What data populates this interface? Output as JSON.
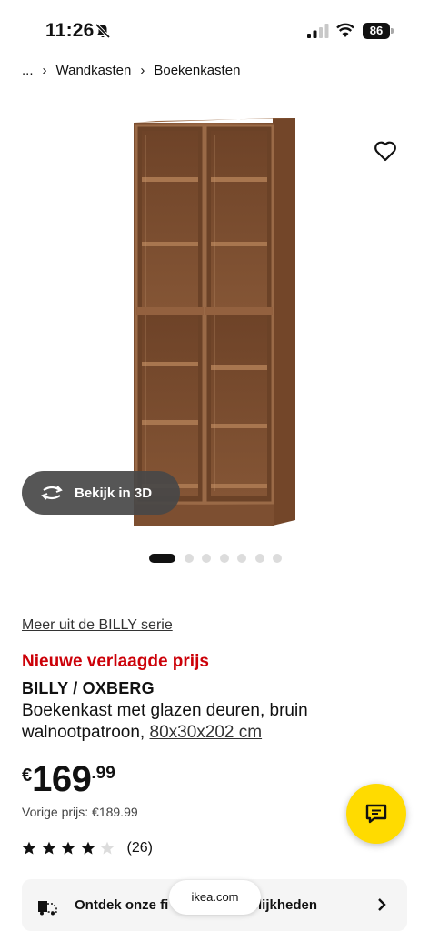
{
  "status_bar": {
    "time": "11:26",
    "battery": "86"
  },
  "breadcrumb": {
    "ellipsis": "...",
    "items": [
      "Wandkasten",
      "Boekenkasten"
    ]
  },
  "gallery": {
    "view_3d_label": "Bekijk in 3D",
    "dots_total": 7,
    "active_index": 0
  },
  "product": {
    "series_link": "Meer uit de BILLY serie",
    "price_tag": "Nieuwe verlaagde prijs",
    "name": "BILLY / OXBERG",
    "description": "Boekenkast met glazen deuren, bruin walnootpatroon, ",
    "size": "80x30x202 cm",
    "price": {
      "currency": "€",
      "amount": "169",
      "decimals": ".99"
    },
    "previous_price": "Vorige prijs: €189.99",
    "rating": {
      "value": 4,
      "max": 5,
      "count": "(26)"
    }
  },
  "banner": {
    "text": "Ontdek onze fi... mogelijkheden",
    "text_left": "Ontdek onze fi",
    "text_right": "ogelijkheden"
  },
  "browser": {
    "url": "ikea.com"
  },
  "colors": {
    "accent_red": "#cc0008",
    "chat_yellow": "#ffdb00",
    "wood": "#8a5a3a"
  },
  "icons": {
    "heart": "heart-icon",
    "chat": "chat-icon",
    "rotate": "rotate-3d-icon",
    "delivery": "delivery-icon",
    "chevron": "chevron-right-icon"
  }
}
